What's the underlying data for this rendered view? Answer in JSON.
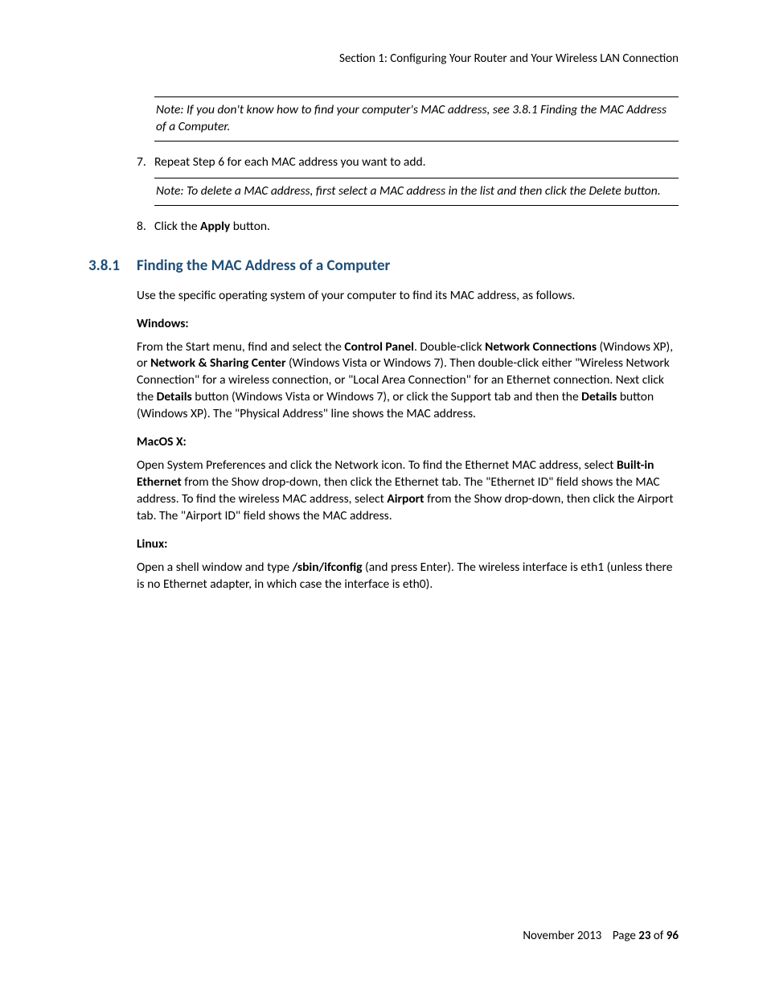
{
  "header": {
    "section_label": "Section 1:  Configuring Your Router and Your Wireless LAN Connection"
  },
  "notes": {
    "note1": "Note: If you don't know how to find your computer's MAC address, see 3.8.1 Finding the MAC Address of a Computer.",
    "note2": "Note:  To delete a MAC address, first select a MAC address in the list and then click the Delete button."
  },
  "list": {
    "item7_num": "7.",
    "item7_text": "Repeat Step 6 for each MAC address you want to add.",
    "item8_num": "8.",
    "item8_pre": "Click the ",
    "item8_bold": "Apply",
    "item8_post": " button."
  },
  "heading": {
    "num": "3.8.1",
    "title": "Finding the MAC Address of a Computer"
  },
  "body": {
    "intro": "Use the specific operating system of your computer to find its MAC address, as follows.",
    "windows_head": "Windows:",
    "win_p1": "From the Start menu, find and select the ",
    "win_b1": "Control Panel",
    "win_p2": ". Double-click ",
    "win_b2": "Network Connections",
    "win_p3": " (Windows XP), or ",
    "win_b3": "Network & Sharing Center",
    "win_p4": " (Windows Vista or Windows 7).  Then double-click either \"Wireless Network Connection\" for a wireless connection, or \"Local Area Connection\" for an Ethernet connection. Next click the ",
    "win_b4": "Details",
    "win_p5": " button (Windows Vista or Windows 7), or click the Support tab and then the ",
    "win_b5": "Details",
    "win_p6": " button (Windows XP).  The \"Physical Address\" line shows the MAC address.",
    "macos_head": "MacOS X:",
    "mac_p1": "Open System Preferences and click the Network icon. To find the Ethernet MAC address, select ",
    "mac_b1": "Built-in Ethernet",
    "mac_p2": " from the Show drop-down, then click the Ethernet tab.  The \"Ethernet ID\" field shows the MAC address. To find the wireless MAC address, select ",
    "mac_b2": "Airport",
    "mac_p3": " from the Show drop-down, then click the Airport tab.  The \"Airport ID\" field shows the MAC address.",
    "linux_head": "Linux:",
    "lin_p1": "Open a shell window and type ",
    "lin_b1": "/sbin/ifconfig",
    "lin_p2": " (and press Enter).  The wireless interface is eth1 (unless there is no Ethernet adapter, in which case the interface is eth0)."
  },
  "footer": {
    "date": "November 2013",
    "page_label_pre": "Page ",
    "page_current": "23",
    "page_of": " of ",
    "page_total": "96"
  }
}
